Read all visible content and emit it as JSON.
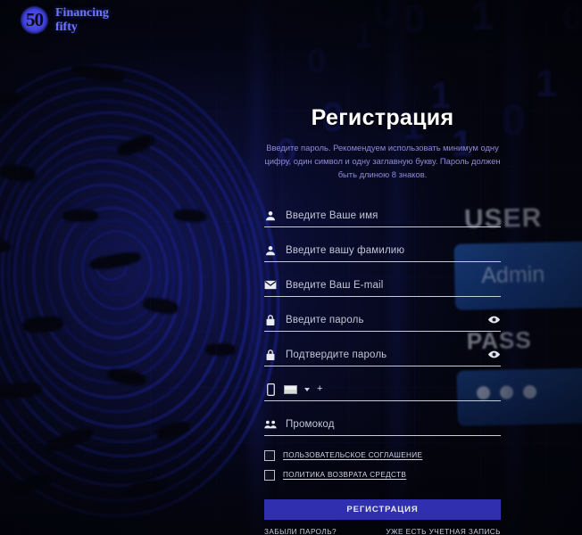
{
  "brand": {
    "logo_number": "50",
    "name_line1": "Financing",
    "name_line2": "fifty",
    "accent_color": "#6e74ff",
    "button_color": "#2f2fb0",
    "subtitle_color": "#8f8ad8"
  },
  "background": {
    "motifs": [
      "fingerprint",
      "binary-digits",
      "login-screen-photo"
    ],
    "login_photo": {
      "user_label": "USER",
      "user_value": "Admin",
      "pass_label": "PASS"
    },
    "binary_digits": [
      "0",
      "0",
      "1",
      "1",
      "1",
      "0",
      "0",
      "1",
      "0",
      "1",
      "0",
      "1",
      "0"
    ]
  },
  "form": {
    "title": "Регистрация",
    "subtitle": "Введите пароль. Рекомендуем использовать минимум одну цифру, один символ и одну заглавную букву. Пароль должен быть длиною 8 знаков.",
    "fields": [
      {
        "name": "first-name",
        "icon": "person-icon",
        "placeholder": "Введите Ваше имя",
        "value": "",
        "has_eye": false
      },
      {
        "name": "last-name",
        "icon": "person-icon",
        "placeholder": "Введите вашу фамилию",
        "value": "",
        "has_eye": false
      },
      {
        "name": "email",
        "icon": "envelope-icon",
        "placeholder": "Введите Ваш E-mail",
        "value": "",
        "has_eye": false
      },
      {
        "name": "password",
        "icon": "lock-icon",
        "placeholder": "Введите пароль",
        "value": "",
        "has_eye": true
      },
      {
        "name": "confirm-password",
        "icon": "lock-icon",
        "placeholder": "Подтвердите пароль",
        "value": "",
        "has_eye": true
      }
    ],
    "phone": {
      "icon": "mobile-phone-icon",
      "flag": "country-flag",
      "caret": "chevron-down-icon",
      "prefix": "+",
      "value": "",
      "placeholder": ""
    },
    "promo": {
      "icon": "group-people-icon",
      "placeholder": "Промокод",
      "value": ""
    },
    "agreements": [
      {
        "name": "user-agreement",
        "label": "ПОЛЬЗОВАТЕЛЬСКОЕ СОГЛАШЕНИЕ",
        "checked": false
      },
      {
        "name": "refund-policy",
        "label": "ПОЛИТИКА ВОЗВРАТА СРЕДСТВ",
        "checked": false
      }
    ],
    "submit_label": "РЕГИСТРАЦИЯ",
    "links": {
      "forgot_password": "ЗАБЫЛИ ПАРОЛЬ?",
      "have_account": "УЖЕ ЕСТЬ УЧЕТНАЯ ЗАПИСЬ"
    }
  }
}
